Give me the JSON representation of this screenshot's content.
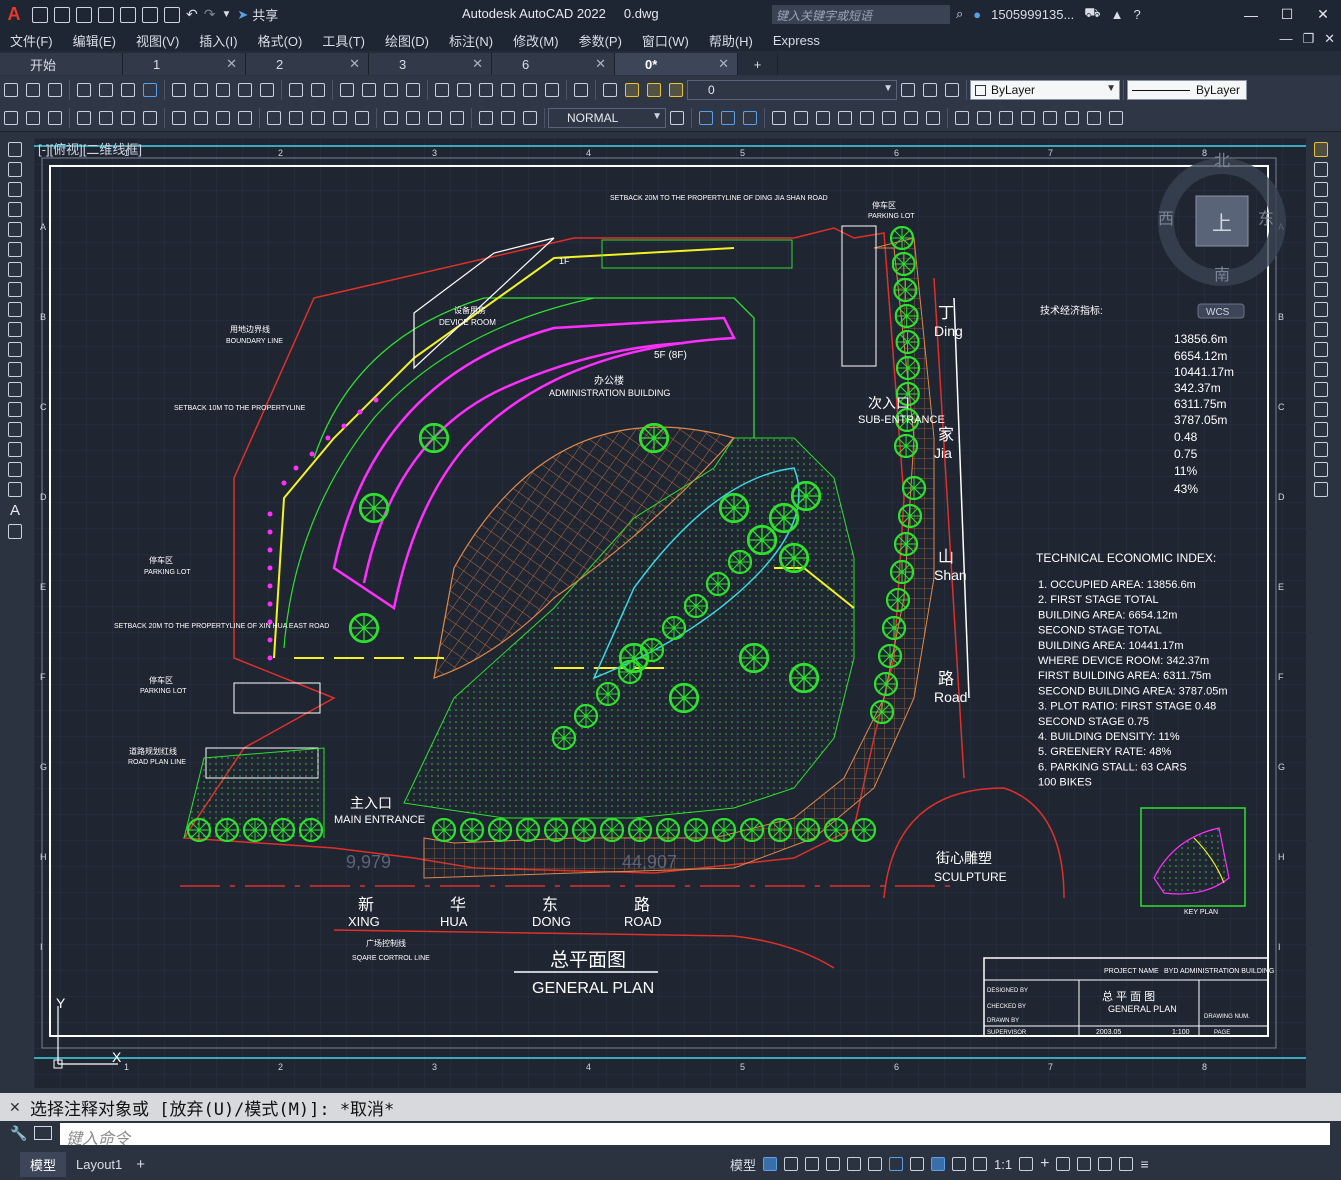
{
  "title_bar": {
    "logo": "A",
    "share_label": "共享",
    "app_title": "Autodesk AutoCAD 2022",
    "file_name": "0.dwg",
    "search_placeholder": "键入关键字或短语",
    "user": "1505999135...",
    "icons": [
      "new-icon",
      "open-icon",
      "save-icon",
      "saveas-icon",
      "print-icon",
      "undo-icon",
      "redo-icon",
      "search-icon",
      "user-icon",
      "cart-icon",
      "help-icon"
    ]
  },
  "menu": {
    "items": [
      "文件(F)",
      "编辑(E)",
      "视图(V)",
      "插入(I)",
      "格式(O)",
      "工具(T)",
      "绘图(D)",
      "标注(N)",
      "修改(M)",
      "参数(P)",
      "窗口(W)",
      "帮助(H)",
      "Express"
    ]
  },
  "tabs": [
    {
      "label": "开始",
      "active": false
    },
    {
      "label": "1",
      "active": false
    },
    {
      "label": "2",
      "active": false
    },
    {
      "label": "3",
      "active": false
    },
    {
      "label": "6",
      "active": false
    },
    {
      "label": "0*",
      "active": true
    }
  ],
  "toolbar": {
    "layer_value": "0",
    "color_value": "ByLayer",
    "linetype_value": "ByLayer",
    "textstyle_value": "NORMAL"
  },
  "viewport": {
    "view_label": "[-][俯视][二维线框]",
    "compass": {
      "north": "北",
      "south": "南",
      "east": "东",
      "west": "西",
      "top": "上"
    },
    "wcs_label": "WCS",
    "col_ticks": [
      "1",
      "2",
      "3",
      "4",
      "5",
      "6",
      "7",
      "8"
    ],
    "row_ticks": [
      "A",
      "B",
      "C",
      "D",
      "E",
      "F",
      "G",
      "H",
      "I"
    ]
  },
  "drawing": {
    "plan_labels": {
      "admin_cn": "办公楼",
      "admin_en": "ADMINISTRATION BUILDING",
      "device_cn": "设备用房",
      "device_en": "DEVICE ROOM",
      "floor_1f": "1F",
      "floor_5f": "5F (8F)",
      "main_entrance_cn": "主入口",
      "main_entrance_en": "MAIN ENTRANCE",
      "sub_entrance_cn": "次入口",
      "sub_entrance_en": "SUB-ENTRANCE",
      "sculpture_cn": "街心雕塑",
      "sculpture_en": "SCULPTURE",
      "parking_cn": "停车区",
      "parking_en": "PARKING LOT",
      "boundary_cn": "用地边界线",
      "boundary_en": "BOUNDARY LINE",
      "road_plan_cn": "道路规划红线",
      "road_plan_en": "ROAD PLAN LINE",
      "square_cn": "广场控制线",
      "square_en": "SQARE CORTROL LINE",
      "setback_west": "SETBACK 10M TO THE PROPERTYLINE",
      "setback_south": "SETBACK 20M TO THE PROPERTYLINE OF XIN HUA EAST ROAD",
      "setback_north": "SETBACK 20M TO THE PROPERTYLINE OF DING JIA SHAN ROAD",
      "dim_left": "9,979",
      "dim_right": "44,907"
    },
    "road_east": [
      {
        "cn": "丁",
        "en": "Ding"
      },
      {
        "cn": "家",
        "en": "Jia"
      },
      {
        "cn": "山",
        "en": "Shan"
      },
      {
        "cn": "路",
        "en": "Road"
      }
    ],
    "road_south": [
      {
        "cn": "新",
        "en": "XING"
      },
      {
        "cn": "华",
        "en": "HUA"
      },
      {
        "cn": "东",
        "en": "DONG"
      },
      {
        "cn": "路",
        "en": "ROAD"
      }
    ],
    "general_plan_cn": "总平面图",
    "general_plan_en": "GENERAL PLAN",
    "index_cn_title": "技术经济指标:",
    "index_cn_values": [
      "13856.6m",
      "6654.12m",
      "10441.17m",
      "342.37m",
      "6311.75m",
      "3787.05m",
      "0.48",
      "0.75",
      "11%",
      "43%"
    ],
    "index_en_title": "TECHNICAL ECONOMIC INDEX:",
    "index_en_lines": [
      "1.   OCCUPIED AREA:  13856.6m",
      "2.     FIRST STAGE TOTAL",
      "       BUILDING AREA:   6654.12m",
      "       SECOND STAGE TOTAL",
      "       BUILDING AREA:   10441.17m",
      "       WHERE DEVICE ROOM: 342.37m",
      "       FIRST BUILDING AREA: 6311.75m",
      "       SECOND BUILDING AREA: 3787.05m",
      "3.   PLOT RATIO:      FIRST STAGE  0.48",
      "                      SECOND STAGE  0.75",
      "4.   BUILDING DENSITY: 11%",
      "5.   GREENERY RATE:   48%",
      "6.   PARKING STALL:   63 CARS",
      "                      100  BIKES"
    ],
    "key_plan": "KEY PLAN",
    "title_block": {
      "project_en": "PROJECT NAME",
      "project_value": "BYD ADMINISTRATION BUILDING",
      "drawing_cn": "总 平 面 图",
      "drawing_en": "GENERAL PLAN",
      "date": "2003.05",
      "scale": "1:100",
      "designed": "DESIGNED BY",
      "drawn": "DRAWN BY",
      "checked": "CHECKED BY",
      "supervisor": "SUPERVISOR",
      "drawing_no": "DRAWING NUM.",
      "page": "PAGE"
    }
  },
  "command": {
    "history": "选择注释对象或 [放弃(U)/模式(M)]: *取消*",
    "input_placeholder": "键入命令"
  },
  "status": {
    "layout_tabs": [
      "模型",
      "Layout1"
    ],
    "model_label": "模型",
    "scale": "1:1"
  },
  "colors": {
    "background": "#1f2531",
    "green": "#2fe02f",
    "yellow": "#f3f323",
    "magenta": "#ff2fff",
    "red": "#e0302a",
    "cyan": "#3fd6e6",
    "orange": "#e0884a"
  }
}
